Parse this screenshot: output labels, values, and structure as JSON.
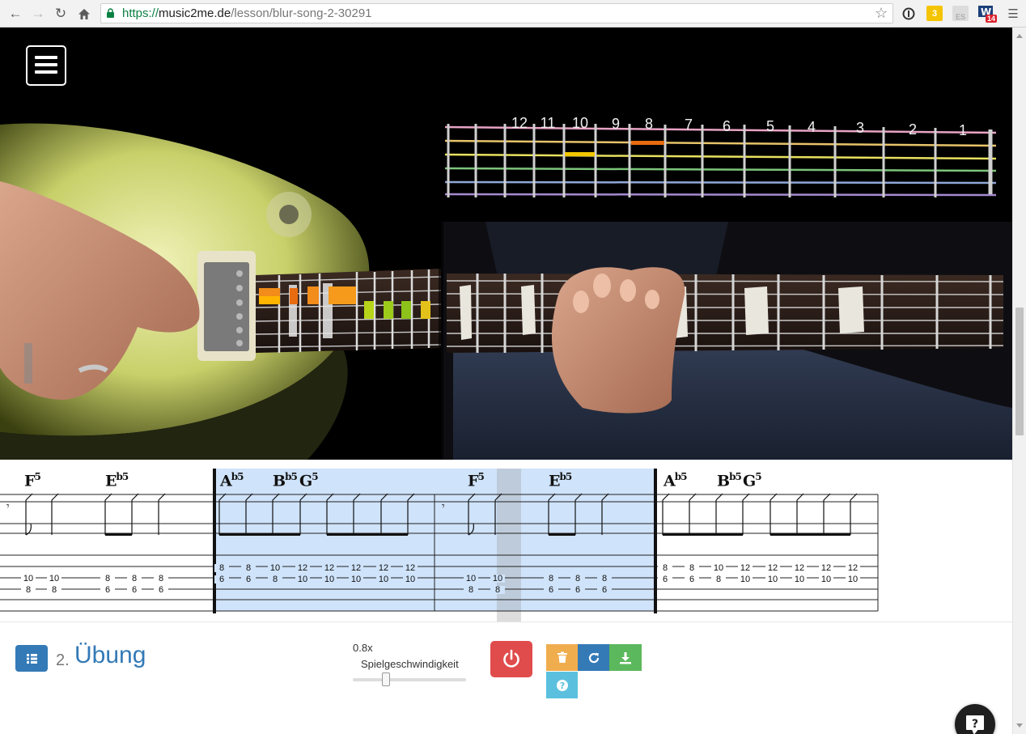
{
  "browser": {
    "url_scheme": "https://",
    "url_host": "music2me.de",
    "url_path": "/lesson/blur-song-2-30291",
    "ext_badges": [
      "3",
      "ES",
      "14"
    ]
  },
  "video": {
    "fret_numbers": [
      "12",
      "11",
      "10",
      "9",
      "8",
      "7",
      "6",
      "5",
      "4",
      "3",
      "2",
      "1"
    ]
  },
  "sheet": {
    "chords": [
      {
        "root": "F",
        "sup": "",
        "quality": "5"
      },
      {
        "root": "E",
        "sup": "b",
        "quality": "5"
      },
      {
        "root": "A",
        "sup": "b",
        "quality": "5"
      },
      {
        "root": "B",
        "sup": "b",
        "quality": "5"
      },
      {
        "root": "G",
        "sup": "",
        "quality": "5"
      },
      {
        "root": "F",
        "sup": "",
        "quality": "5"
      },
      {
        "root": "E",
        "sup": "b",
        "quality": "5"
      },
      {
        "root": "A",
        "sup": "b",
        "quality": "5"
      },
      {
        "root": "B",
        "sup": "b",
        "quality": "5"
      },
      {
        "root": "G",
        "sup": "",
        "quality": "5"
      }
    ],
    "tab_notes": [
      [
        "10",
        "8"
      ],
      [
        "10",
        "8"
      ],
      [
        "8",
        "6"
      ],
      [
        "8",
        "6"
      ],
      [
        "8",
        "6"
      ],
      [
        "8",
        "6"
      ],
      [
        "8",
        "6"
      ],
      [
        "10",
        "8"
      ],
      [
        "12",
        "10"
      ],
      [
        "12",
        "10"
      ],
      [
        "12",
        "10"
      ],
      [
        "12",
        "10"
      ],
      [
        "12",
        "10"
      ],
      [
        "10",
        "8"
      ],
      [
        "10",
        "8"
      ],
      [
        "8",
        "6"
      ],
      [
        "8",
        "6"
      ],
      [
        "8",
        "6"
      ],
      [
        "8",
        "6"
      ],
      [
        "8",
        "6"
      ],
      [
        "10",
        "8"
      ],
      [
        "12",
        "10"
      ],
      [
        "12",
        "10"
      ],
      [
        "12",
        "10"
      ],
      [
        "12",
        "10"
      ],
      [
        "12",
        "10"
      ]
    ]
  },
  "controls": {
    "exercise_number": "2.",
    "exercise_title": "Übung",
    "speed_value": "0.8x",
    "speed_label": "Spielgeschwindigkeit",
    "speed_fraction": 0.29,
    "colors": {
      "primary": "#337ab7",
      "danger": "#e04c4c",
      "warning": "#f0ad4e",
      "success": "#5cb85c",
      "info": "#5bc0de"
    }
  }
}
